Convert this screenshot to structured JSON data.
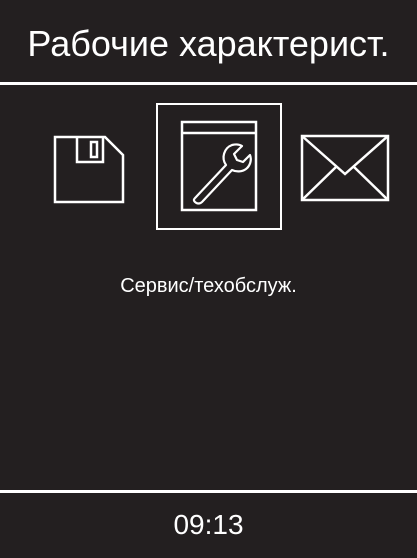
{
  "header": {
    "title": "Рабочие характерист."
  },
  "menu": {
    "items": [
      {
        "id": "save",
        "icon": "floppy-disk-icon",
        "selected": false
      },
      {
        "id": "service",
        "icon": "wrench-window-icon",
        "selected": true
      },
      {
        "id": "mail",
        "icon": "envelope-icon",
        "selected": false
      }
    ],
    "selected_caption": "Сервис/техобслуж."
  },
  "footer": {
    "time": "09:13"
  },
  "colors": {
    "background": "#231f20",
    "foreground": "#ffffff"
  }
}
